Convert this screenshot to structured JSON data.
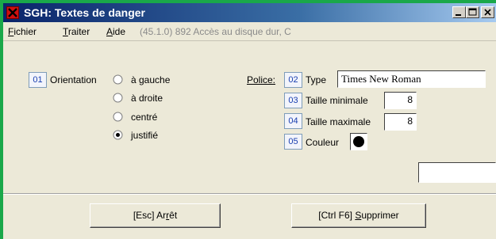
{
  "window": {
    "title": "SGH: Textes de danger"
  },
  "menu": {
    "fichier_first": "F",
    "fichier_rest": "ichier",
    "traiter_first": "T",
    "traiter_rest": "raiter",
    "aide_first": "A",
    "aide_rest": "ide",
    "status_info": "(45.1.0) 892 Accès au disque dur, C"
  },
  "orientation": {
    "number": "01",
    "label": "Orientation",
    "options": [
      {
        "label": "à gauche",
        "selected": false
      },
      {
        "label": "à droite",
        "selected": false
      },
      {
        "label": "centré",
        "selected": false
      },
      {
        "label": "justifié",
        "selected": true
      }
    ]
  },
  "police": {
    "label": "Police:",
    "type": {
      "number": "02",
      "label": "Type",
      "value": "Times New Roman"
    },
    "min_size": {
      "number": "03",
      "label": "Taille minimale",
      "value": "8"
    },
    "max_size": {
      "number": "04",
      "label": "Taille maximale",
      "value": "8"
    },
    "color": {
      "number": "05",
      "label": "Couleur",
      "value": "#000000"
    }
  },
  "extra_field": {
    "value": ""
  },
  "buttons": {
    "stop": {
      "prefix": "[Esc] Ar",
      "key": "r",
      "suffix": "êt"
    },
    "delete": {
      "prefix": "[Ctrl F6] ",
      "key": "S",
      "suffix": "upprimer"
    }
  },
  "icons": {
    "app": "close-x-icon",
    "minimize": "minimize-icon",
    "maximize": "maximize-icon",
    "close": "close-icon"
  },
  "colors": {
    "title_gradient_start": "#0a246a",
    "title_gradient_end": "#a6caf0",
    "number_text": "#1a3fb0",
    "outer_frame": "#1aa84a"
  }
}
